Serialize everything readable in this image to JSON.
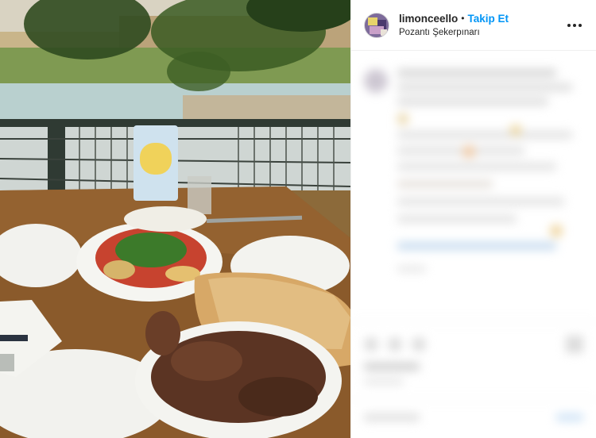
{
  "post": {
    "username": "limonceello",
    "separator": "•",
    "follow_label": "Takip Et",
    "location": "Pozantı Şekerpınarı",
    "more_icon": "more-options-icon",
    "image_description_icons": [
      "food-photo"
    ]
  },
  "colors": {
    "follow": "#0095f6",
    "border": "#efefef",
    "text": "#262626"
  }
}
